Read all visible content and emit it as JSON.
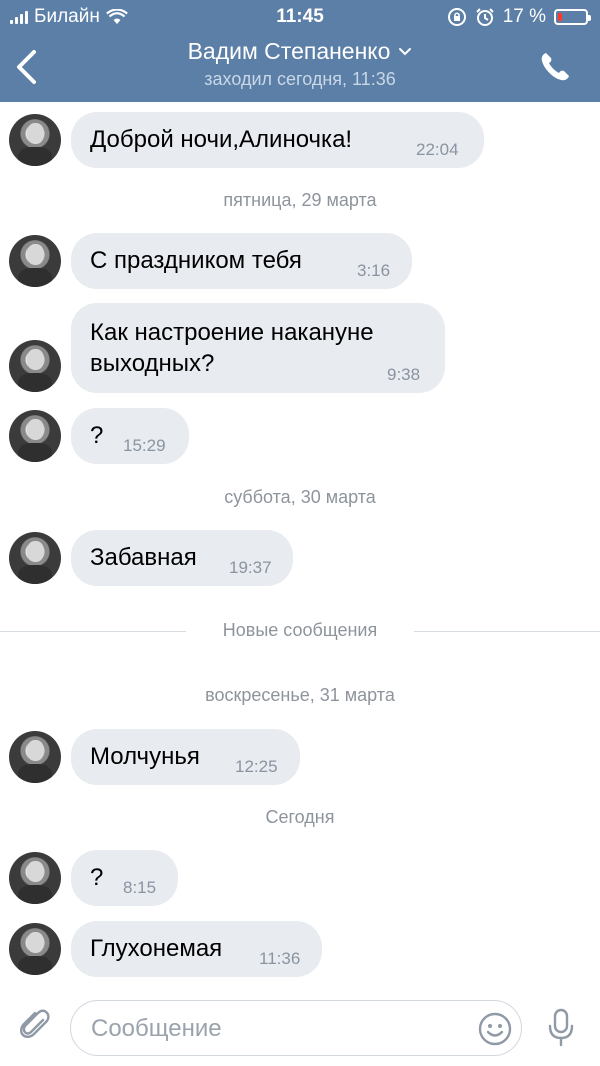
{
  "status_bar": {
    "carrier": "Билайн",
    "time": "11:45",
    "battery": "17 %",
    "battery_level": 0.17
  },
  "header": {
    "title": "Вадим Степаненко",
    "subtitle": "заходил сегодня, 11:36",
    "icons": {
      "back": "chevron-left-icon",
      "expand": "chevron-down-icon",
      "call": "phone-icon"
    }
  },
  "messages": [
    {
      "text": "Доброй ночи,Алиночка!",
      "time": "22:04"
    },
    {
      "text": "С праздником тебя",
      "time": "3:16"
    },
    {
      "text": "Как настроение накануне\nвыходных?",
      "time": "9:38"
    },
    {
      "text": "?",
      "time": "15:29"
    },
    {
      "text": "Забавная",
      "time": "19:37"
    },
    {
      "text": "Молчунья",
      "time": "12:25"
    },
    {
      "text": "?",
      "time": "8:15"
    },
    {
      "text": "Глухонемая",
      "time": "11:36"
    }
  ],
  "dates": {
    "friday": "пятница, 29 марта",
    "saturday": "суббота, 30 марта",
    "sunday": "воскресенье, 31 марта",
    "today": "Сегодня"
  },
  "new_messages_label": "Новые сообщения",
  "composer": {
    "placeholder": "Сообщение",
    "icons": {
      "attach": "paperclip-icon",
      "emoji": "smiley-icon",
      "voice": "microphone-icon"
    }
  },
  "colors": {
    "header_bg": "#5b7fa6",
    "bubble_bg": "#e8ebf0",
    "battery_low": "#ff3b30"
  }
}
